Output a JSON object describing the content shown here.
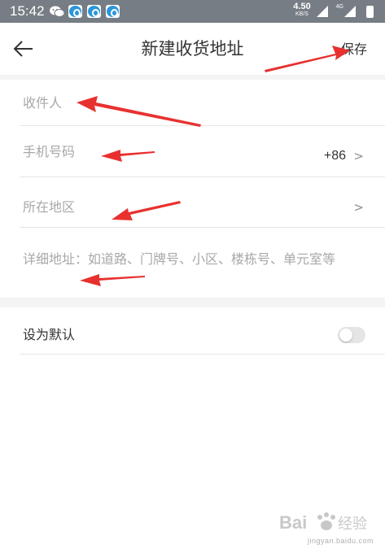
{
  "status_bar": {
    "time": "15:42",
    "speed_value": "4.50",
    "speed_unit": "KB/S",
    "network": "4G",
    "icons": [
      "wechat-icon",
      "app-badge-icon",
      "app-badge-icon",
      "app-badge-icon",
      "wifi-signal-icon",
      "cell-signal-icon",
      "battery-icon"
    ]
  },
  "header": {
    "back_icon": "arrow-left-icon",
    "title": "新建收货地址",
    "save_label": "保存"
  },
  "form": {
    "recipient": {
      "placeholder": "收件人"
    },
    "phone": {
      "placeholder": "手机号码",
      "country_code": "+86",
      "chevron": ">"
    },
    "region": {
      "label": "所在地区",
      "chevron": ">"
    },
    "address": {
      "placeholder": "详细地址：如道路、门牌号、小区、楼栋号、单元室等"
    }
  },
  "default_setting": {
    "label": "设为默认",
    "enabled": false
  },
  "colors": {
    "status_bar": "#777d84",
    "text_primary": "#333333",
    "placeholder": "#a8a8a8",
    "divider": "#e6e6e6",
    "section_gap": "#f4f4f4",
    "toggle_off": "#e5e5e5",
    "annotation_arrow": "#e8312f"
  },
  "watermark": {
    "brand": "Bai 经验",
    "domain": "jingyan.baidu.com"
  }
}
